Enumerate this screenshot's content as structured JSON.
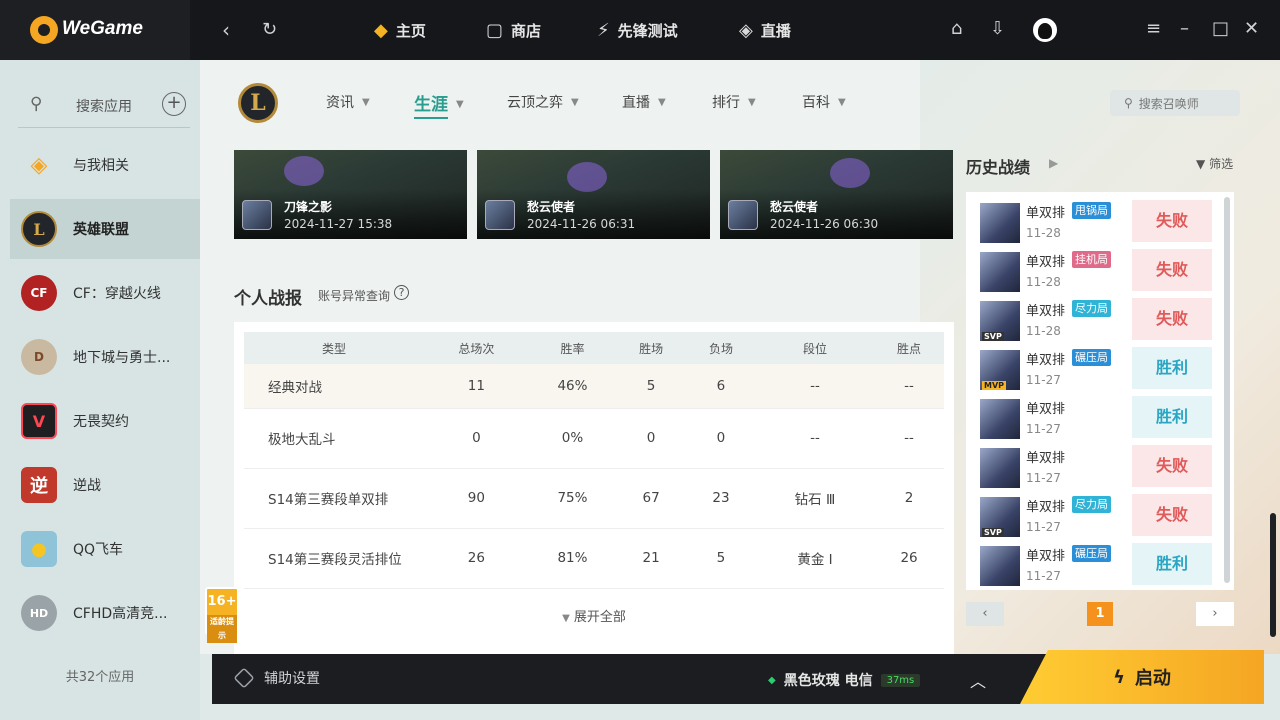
{
  "brand": {
    "name": "WeGame"
  },
  "topnav": [
    {
      "label": "主页",
      "icon": "home-icon",
      "active": true
    },
    {
      "label": "商店",
      "icon": "store-icon",
      "active": false
    },
    {
      "label": "先锋测试",
      "icon": "pioneer-test-icon",
      "active": false
    },
    {
      "label": "直播",
      "icon": "live-icon",
      "active": false
    }
  ],
  "sidebar": {
    "search_placeholder": "搜索应用",
    "apps": [
      {
        "label": "与我相关"
      },
      {
        "label": "英雄联盟"
      },
      {
        "label": "CF：穿越火线"
      },
      {
        "label": "地下城与勇士..."
      },
      {
        "label": "无畏契约"
      },
      {
        "label": "逆战"
      },
      {
        "label": "QQ飞车"
      },
      {
        "label": "CFHD高清竞..."
      }
    ],
    "count_label": "共32个应用"
  },
  "subnav": [
    {
      "label": "资讯"
    },
    {
      "label": "生涯"
    },
    {
      "label": "云顶之弈"
    },
    {
      "label": "直播"
    },
    {
      "label": "排行"
    },
    {
      "label": "百科"
    }
  ],
  "summoner_search": {
    "placeholder": "搜索召唤师"
  },
  "clips": [
    {
      "name": "刀锋之影",
      "date": "2024-11-27 15:38"
    },
    {
      "name": "愁云使者",
      "date": "2024-11-26 06:31"
    },
    {
      "name": "愁云使者",
      "date": "2024-11-26 06:30"
    }
  ],
  "report": {
    "title": "个人战报",
    "link": "账号异常查询",
    "help": "?",
    "columns": [
      "类型",
      "总场次",
      "胜率",
      "胜场",
      "负场",
      "段位",
      "胜点"
    ],
    "rows": [
      [
        "经典对战",
        "11",
        "46%",
        "5",
        "6",
        "--",
        "--"
      ],
      [
        "极地大乱斗",
        "0",
        "0%",
        "0",
        "0",
        "--",
        "--"
      ],
      [
        "S14第三赛段单双排",
        "90",
        "75%",
        "67",
        "23",
        "钻石 Ⅲ",
        "2"
      ],
      [
        "S14第三赛段灵活排位",
        "26",
        "81%",
        "21",
        "5",
        "黄金 Ⅰ",
        "26"
      ]
    ],
    "expand_label": "展开全部"
  },
  "age_badge": {
    "rating": "16+",
    "note": "适龄提示"
  },
  "history": {
    "title": "历史战绩",
    "filter_label": "筛选",
    "matches": [
      {
        "mode": "单双排",
        "tag": "甩锅局",
        "tag_color": "#2a8fd6",
        "date": "11-28",
        "result": "失败",
        "outcome": "lose",
        "badge": ""
      },
      {
        "mode": "单双排",
        "tag": "挂机局",
        "tag_color": "#e06a8a",
        "date": "11-28",
        "result": "失败",
        "outcome": "lose",
        "badge": ""
      },
      {
        "mode": "单双排",
        "tag": "尽力局",
        "tag_color": "#2fb3d6",
        "date": "11-28",
        "result": "失败",
        "outcome": "lose",
        "badge": "svp"
      },
      {
        "mode": "单双排",
        "tag": "碾压局",
        "tag_color": "#2a8fd6",
        "date": "11-27",
        "result": "胜利",
        "outcome": "win",
        "badge": "mvp"
      },
      {
        "mode": "单双排",
        "tag": "",
        "tag_color": "",
        "date": "11-27",
        "result": "胜利",
        "outcome": "win",
        "badge": ""
      },
      {
        "mode": "单双排",
        "tag": "",
        "tag_color": "",
        "date": "11-27",
        "result": "失败",
        "outcome": "lose",
        "badge": ""
      },
      {
        "mode": "单双排",
        "tag": "尽力局",
        "tag_color": "#2fb3d6",
        "date": "11-27",
        "result": "失败",
        "outcome": "lose",
        "badge": "svp"
      },
      {
        "mode": "单双排",
        "tag": "碾压局",
        "tag_color": "#2a8fd6",
        "date": "11-27",
        "result": "胜利",
        "outcome": "win",
        "badge": ""
      }
    ],
    "pager": {
      "prev": "‹",
      "page": "1",
      "next": "›"
    }
  },
  "bottombar": {
    "assist_label": "辅助设置",
    "server": "黑色玫瑰 电信",
    "ping": "37ms",
    "launch_label": "启动"
  }
}
